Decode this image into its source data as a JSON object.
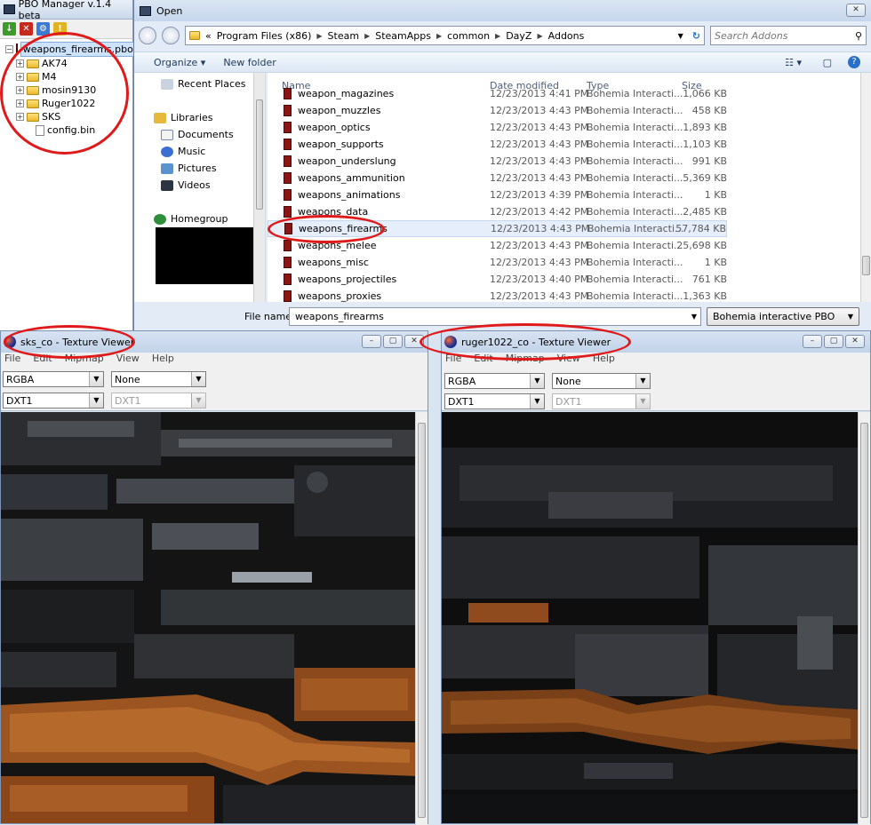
{
  "pbo_manager": {
    "title": "PBO Manager v.1.4 beta",
    "tree": {
      "root": "weapons_firearms.pbo",
      "folders": [
        "AK74",
        "M4",
        "mosin9130",
        "Ruger1022",
        "SKS"
      ],
      "file": "config.bin"
    }
  },
  "open_dialog": {
    "title": "Open",
    "breadcrumb": [
      "«",
      "Program Files (x86)",
      "Steam",
      "SteamApps",
      "common",
      "DayZ",
      "Addons"
    ],
    "search_placeholder": "Search Addons",
    "organize_label": "Organize ▾",
    "new_folder_label": "New folder",
    "nav": {
      "recent": "Recent Places",
      "libraries": "Libraries",
      "documents": "Documents",
      "music": "Music",
      "pictures": "Pictures",
      "videos": "Videos",
      "homegroup": "Homegroup"
    },
    "columns": {
      "name": "Name",
      "date": "Date modified",
      "type": "Type",
      "size": "Size"
    },
    "files": [
      {
        "name": "weapon_magazines",
        "date": "12/23/2013 4:41 PM",
        "type": "Bohemia Interacti...",
        "size": "1,066 KB"
      },
      {
        "name": "weapon_muzzles",
        "date": "12/23/2013 4:43 PM",
        "type": "Bohemia Interacti...",
        "size": "458 KB"
      },
      {
        "name": "weapon_optics",
        "date": "12/23/2013 4:43 PM",
        "type": "Bohemia Interacti...",
        "size": "1,893 KB"
      },
      {
        "name": "weapon_supports",
        "date": "12/23/2013 4:43 PM",
        "type": "Bohemia Interacti...",
        "size": "1,103 KB"
      },
      {
        "name": "weapon_underslung",
        "date": "12/23/2013 4:43 PM",
        "type": "Bohemia Interacti...",
        "size": "991 KB"
      },
      {
        "name": "weapons_ammunition",
        "date": "12/23/2013 4:43 PM",
        "type": "Bohemia Interacti...",
        "size": "5,369 KB"
      },
      {
        "name": "weapons_animations",
        "date": "12/23/2013 4:39 PM",
        "type": "Bohemia Interacti...",
        "size": "1 KB"
      },
      {
        "name": "weapons_data",
        "date": "12/23/2013 4:42 PM",
        "type": "Bohemia Interacti...",
        "size": "2,485 KB"
      },
      {
        "name": "weapons_firearms",
        "date": "12/23/2013 4:43 PM",
        "type": "Bohemia Interacti...",
        "size": "57,784 KB"
      },
      {
        "name": "weapons_melee",
        "date": "12/23/2013 4:43 PM",
        "type": "Bohemia Interacti...",
        "size": "25,698 KB"
      },
      {
        "name": "weapons_misc",
        "date": "12/23/2013 4:43 PM",
        "type": "Bohemia Interacti...",
        "size": "1 KB"
      },
      {
        "name": "weapons_projectiles",
        "date": "12/23/2013 4:40 PM",
        "type": "Bohemia Interacti...",
        "size": "761 KB"
      },
      {
        "name": "weapons_proxies",
        "date": "12/23/2013 4:43 PM",
        "type": "Bohemia Interacti...",
        "size": "1,363 KB"
      }
    ],
    "file_name_label": "File name:",
    "file_name_value": "weapons_firearms",
    "file_type": "Bohemia interactive PBO"
  },
  "viewer_left": {
    "title": "sks_co - Texture Viewer",
    "menu": [
      "File",
      "Edit",
      "Mipmap",
      "View",
      "Help"
    ],
    "format": "RGBA",
    "channel": "None",
    "compression": "DXT1",
    "compression2": "DXT1"
  },
  "viewer_right": {
    "title": "ruger1022_co - Texture Viewer",
    "menu": [
      "File",
      "Edit",
      "Mipmap",
      "View",
      "Help"
    ],
    "format": "RGBA",
    "channel": "None",
    "compression": "DXT1",
    "compression2": "DXT1"
  },
  "colors": {
    "annotation": "#e01a1a",
    "selection": "#cde2fb",
    "wood": "#a0541d"
  }
}
